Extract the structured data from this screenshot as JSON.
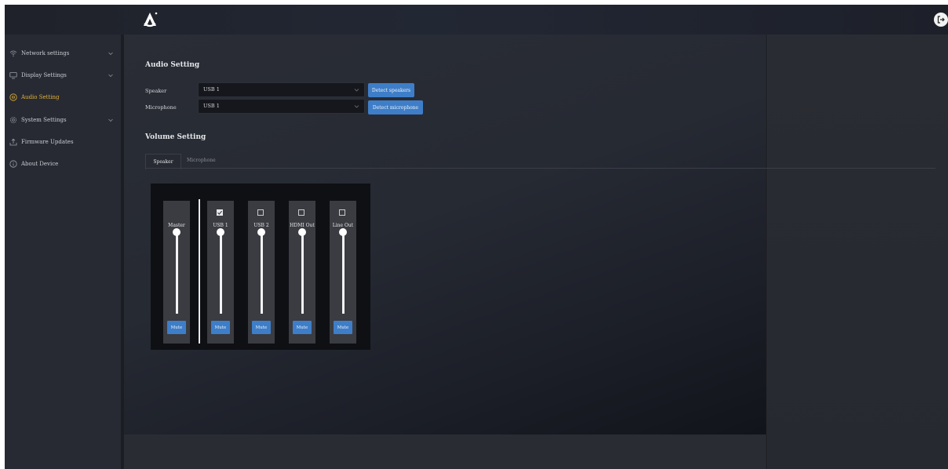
{
  "sidebar": {
    "items": [
      {
        "label": "Network settings",
        "icon": "wifi-icon",
        "active": false,
        "expandable": true
      },
      {
        "label": "Display Settings",
        "icon": "monitor-icon",
        "active": false,
        "expandable": true
      },
      {
        "label": "Audio Setting",
        "icon": "audio-icon",
        "active": true,
        "expandable": false
      },
      {
        "label": "System Settings",
        "icon": "gear-icon",
        "active": false,
        "expandable": true
      },
      {
        "label": "Firmware Updates",
        "icon": "upload-icon",
        "active": false,
        "expandable": false
      },
      {
        "label": "About Device",
        "icon": "info-icon",
        "active": false,
        "expandable": false
      }
    ]
  },
  "audio": {
    "title": "Audio Setting",
    "speaker_label": "Speaker",
    "speaker_value": "USB 1",
    "detect_speakers": "Detect speakers",
    "microphone_label": "Microphone",
    "microphone_value": "USB 1",
    "detect_microphone": "Detect microphone"
  },
  "volume": {
    "title": "Volume Setting",
    "tabs": [
      "Speaker",
      "Microphone"
    ],
    "active_tab": "Speaker",
    "channels": [
      {
        "name": "Master",
        "has_checkbox": false,
        "checked": false,
        "mute_label": "Mute"
      },
      {
        "name": "USB 1",
        "has_checkbox": true,
        "checked": true,
        "mute_label": "Mute"
      },
      {
        "name": "USB 2",
        "has_checkbox": true,
        "checked": false,
        "mute_label": "Mute"
      },
      {
        "name": "HDMI Out",
        "has_checkbox": true,
        "checked": false,
        "mute_label": "Mute"
      },
      {
        "name": "Line Out",
        "has_checkbox": true,
        "checked": false,
        "mute_label": "Mute"
      }
    ]
  },
  "colors": {
    "accent": "#3e7ec8",
    "active_nav": "#e3b33a",
    "background": "#22252c"
  }
}
